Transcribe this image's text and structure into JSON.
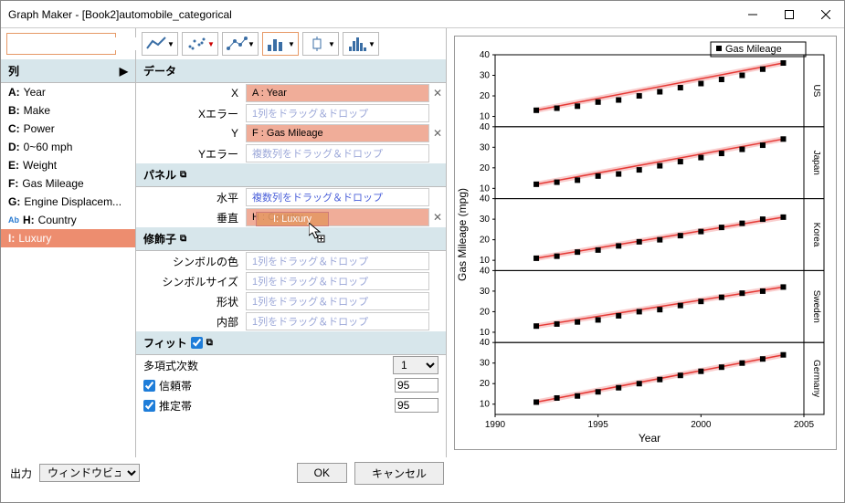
{
  "window": {
    "title": "Graph Maker - [Book2]automobile_categorical"
  },
  "columns": {
    "header": "列",
    "items": [
      {
        "prefix": "A:",
        "label": "Year"
      },
      {
        "prefix": "B:",
        "label": "Make"
      },
      {
        "prefix": "C:",
        "label": "Power"
      },
      {
        "prefix": "D:",
        "label": "0~60 mph"
      },
      {
        "prefix": "E:",
        "label": "Weight"
      },
      {
        "prefix": "F:",
        "label": "Gas Mileage"
      },
      {
        "prefix": "G:",
        "label": "Engine Displacem..."
      },
      {
        "prefix": "H:",
        "label": "Country"
      },
      {
        "prefix": "I:",
        "label": "Luxury"
      }
    ]
  },
  "data_section": {
    "header": "データ",
    "x_label": "X",
    "x_value": "A : Year",
    "xerr_label": "Xエラー",
    "xerr_hint": "1列をドラッグ＆ドロップ",
    "y_label": "Y",
    "y_value": "F : Gas Mileage",
    "yerr_label": "Yエラー",
    "yerr_hint": "複数列をドラッグ＆ドロップ"
  },
  "panel_section": {
    "header": "パネル",
    "horiz_label": "水平",
    "horiz_hint": "複数列をドラッグ＆ドロップ",
    "vert_label": "垂直",
    "vert_value": "H : Country"
  },
  "modifier_section": {
    "header": "修飾子",
    "color_label": "シンボルの色",
    "size_label": "シンボルサイズ",
    "shape_label": "形状",
    "interior_label": "内部",
    "hint": "1列をドラッグ＆ドロップ"
  },
  "fit_section": {
    "header": "フィット",
    "polydeg_label": "多項式次数",
    "polydeg_value": "1",
    "confband_label": "信頼帯",
    "confband_value": "95",
    "predband_label": "推定帯",
    "predband_value": "95"
  },
  "dragging": "I: Luxury",
  "footer": {
    "output_label": "出力",
    "output_value": "ウィンドウビュー",
    "ok": "OK",
    "cancel": "キャンセル"
  },
  "chart_data": {
    "type": "scatter",
    "multipanel": true,
    "panel_by": "Country",
    "xlabel": "Year",
    "ylabel": "Gas Mileage (mpg)",
    "xlim": [
      1990,
      2005
    ],
    "ylim": [
      5,
      40
    ],
    "xticks": [
      1990,
      1995,
      2000,
      2005
    ],
    "yticks": [
      10,
      20,
      30,
      40
    ],
    "legend": {
      "label": "Gas Mileage",
      "position": "top-right"
    },
    "fit": {
      "type": "linear",
      "confidence_band": 95
    },
    "panels": [
      {
        "name": "US",
        "x": [
          1992,
          1993,
          1994,
          1995,
          1996,
          1997,
          1998,
          1999,
          2000,
          2001,
          2002,
          2003,
          2004
        ],
        "y": [
          13,
          14,
          15,
          17,
          18,
          20,
          22,
          24,
          26,
          28,
          30,
          33,
          36
        ]
      },
      {
        "name": "Japan",
        "x": [
          1992,
          1993,
          1994,
          1995,
          1996,
          1997,
          1998,
          1999,
          2000,
          2001,
          2002,
          2003,
          2004
        ],
        "y": [
          12,
          13,
          14,
          16,
          17,
          19,
          21,
          23,
          25,
          27,
          29,
          31,
          34
        ]
      },
      {
        "name": "Korea",
        "x": [
          1992,
          1993,
          1994,
          1995,
          1996,
          1997,
          1998,
          1999,
          2000,
          2001,
          2002,
          2003,
          2004
        ],
        "y": [
          11,
          12,
          14,
          15,
          17,
          19,
          20,
          22,
          24,
          26,
          28,
          30,
          31
        ]
      },
      {
        "name": "Sweden",
        "x": [
          1992,
          1993,
          1994,
          1995,
          1996,
          1997,
          1998,
          1999,
          2000,
          2001,
          2002,
          2003,
          2004
        ],
        "y": [
          13,
          14,
          15,
          16,
          18,
          20,
          21,
          23,
          25,
          27,
          29,
          30,
          32
        ]
      },
      {
        "name": "Germany",
        "x": [
          1992,
          1993,
          1994,
          1995,
          1996,
          1997,
          1998,
          1999,
          2000,
          2001,
          2002,
          2003,
          2004
        ],
        "y": [
          11,
          13,
          14,
          16,
          18,
          20,
          22,
          24,
          26,
          28,
          30,
          32,
          34
        ]
      }
    ]
  }
}
